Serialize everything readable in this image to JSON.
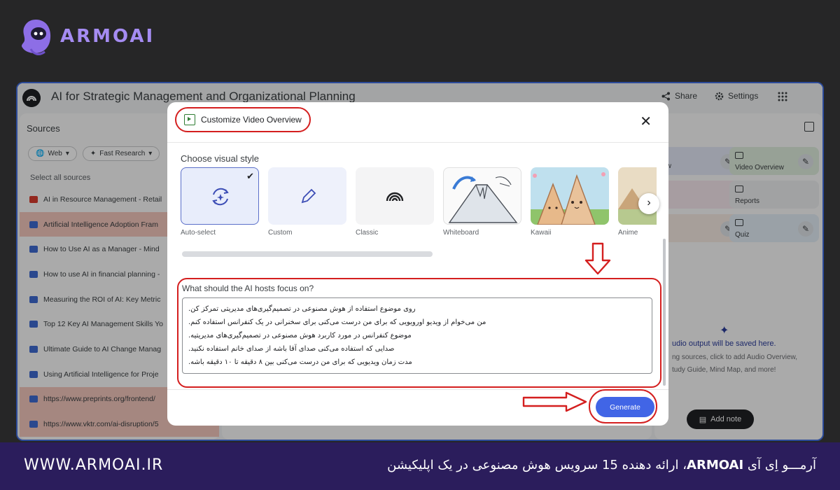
{
  "brand": {
    "name": "ARMOAI"
  },
  "footer": {
    "url": "WWW.ARMOAI.IR",
    "tagline_prefix": "آرمـــو اِی آی ",
    "tagline_brand": "ARMOAI",
    "tagline_rest": "، ارائه دهنده 15 سرویس هوش مصنوعی در یک اپلیکیشن"
  },
  "app": {
    "title": "AI for Strategic Management and Organizational Planning",
    "share_label": "Share",
    "settings_label": "Settings"
  },
  "sources": {
    "title": "Sources",
    "filter_web": "Web",
    "filter_research": "Fast Research",
    "select_all": "Select all sources",
    "items": [
      {
        "label": "AI in Resource Management - Retail",
        "type": "pdf",
        "highlighted": false
      },
      {
        "label": "Artificial Intelligence Adoption Fram",
        "type": "doc",
        "highlighted": true
      },
      {
        "label": "How to Use AI as a Manager - Mind",
        "type": "doc",
        "highlighted": false
      },
      {
        "label": "How to use AI in financial planning -",
        "type": "doc",
        "highlighted": false
      },
      {
        "label": "Measuring the ROI of AI: Key Metric",
        "type": "doc",
        "highlighted": false
      },
      {
        "label": "Top 12 Key AI Management Skills Yo",
        "type": "doc",
        "highlighted": false
      },
      {
        "label": "Ultimate Guide to AI Change Manag",
        "type": "doc",
        "highlighted": false
      },
      {
        "label": "Using Artificial Intelligence for Proje",
        "type": "doc",
        "highlighted": false
      },
      {
        "label": "https://www.preprints.org/frontend/",
        "type": "doc",
        "highlighted": true
      },
      {
        "label": "https://www.vktr.com/ai-disruption/5",
        "type": "doc",
        "highlighted": true
      }
    ]
  },
  "studio": {
    "tile_overview_partial": "view",
    "tile_video": "Video Overview",
    "tile_reports": "Reports",
    "tile_quiz": "Quiz",
    "output_title": "udio output will be saved here.",
    "output_desc_1": "ng sources, click to add Audio Overview,",
    "output_desc_2": "tudy Guide, Mind Map, and more!",
    "add_note": "Add note"
  },
  "modal": {
    "title": "Customize Video Overview",
    "choose_label": "Choose visual style",
    "styles": [
      {
        "name": "Auto-select",
        "selected": true
      },
      {
        "name": "Custom",
        "selected": false
      },
      {
        "name": "Classic",
        "selected": false
      },
      {
        "name": "Whiteboard",
        "selected": false
      },
      {
        "name": "Kawaii",
        "selected": false
      },
      {
        "name": "Anime",
        "selected": false
      }
    ],
    "focus_label": "What should the AI hosts focus on?",
    "focus_lines": [
      "روی موضوع استفاده از هوش مصنوعی در تصمیم‌گیری‌های مدیریتی تمرکز کن.",
      "من می‌خوام از ویدیو اورویویی که برای من درست می‌کنی برای سخنرانی در یک کنفرانس استفاده کنم.",
      "موضوع کنفرانس در مورد کاربرد هوش مصنوعی در تصمیم‌گیری‌های مدیریتیه.",
      "صدایی که استفاده می‌کنی صدای آقا باشه از صدای خانم استفاده نکنید.",
      "مدت زمان ویدیویی که برای من درست می‌کنی بین ۸ دقیقه تا ۱۰ دقیقه باشه."
    ],
    "generate_label": "Generate"
  },
  "colors": {
    "accent": "#4165e6",
    "annotation": "#d41f1f",
    "brand": "#a58cf2",
    "footer_bg": "#2b1d5c"
  }
}
